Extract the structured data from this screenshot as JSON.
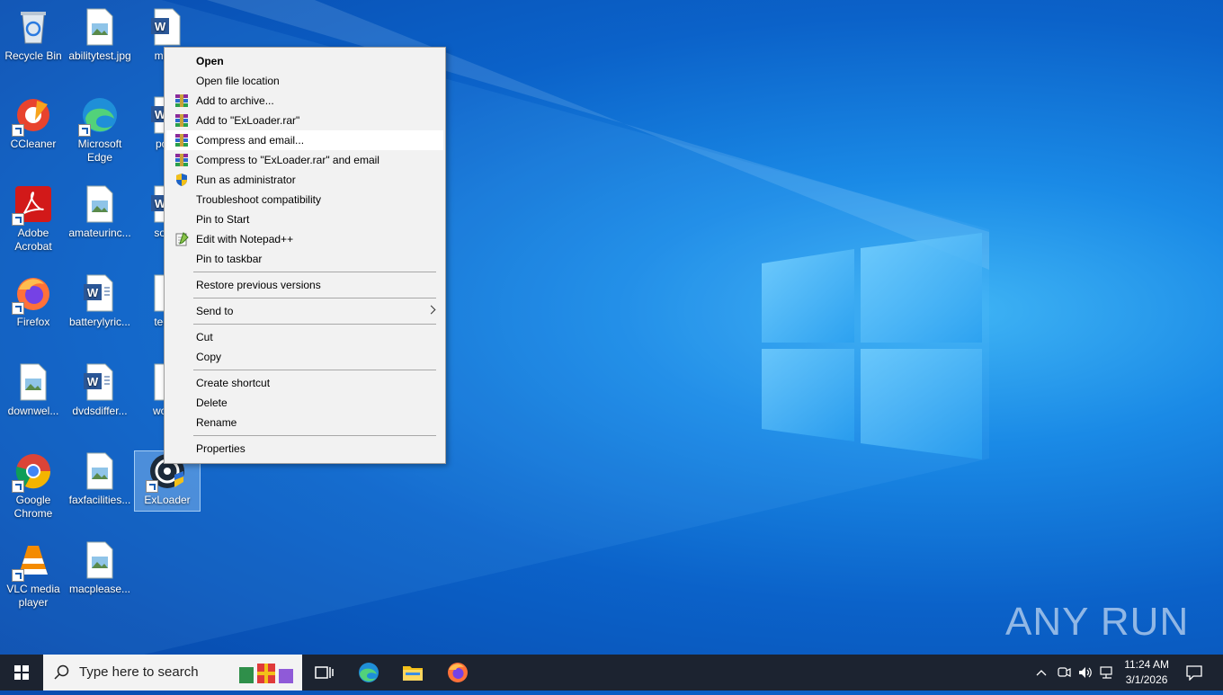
{
  "desktop": {
    "icons": [
      {
        "label": "Recycle Bin"
      },
      {
        "label": "abilitytest.jpg"
      },
      {
        "label": "muck"
      },
      {
        "label": "CCleaner"
      },
      {
        "label": "Microsoft Edge"
      },
      {
        "label": "point"
      },
      {
        "label": "Adobe Acrobat"
      },
      {
        "label": "amateurinc..."
      },
      {
        "label": "some"
      },
      {
        "label": "Firefox"
      },
      {
        "label": "batterylyric..."
      },
      {
        "label": "teens"
      },
      {
        "label": "downwel..."
      },
      {
        "label": "dvdsdiffer..."
      },
      {
        "label": "woma"
      },
      {
        "label": "Google Chrome"
      },
      {
        "label": "faxfacilities..."
      },
      {
        "label": "ExLoader"
      },
      {
        "label": "VLC media player"
      },
      {
        "label": "macplease..."
      }
    ]
  },
  "context_menu": {
    "items": [
      {
        "label": "Open",
        "icon": "none"
      },
      {
        "label": "Open file location",
        "icon": "none"
      },
      {
        "label": "Add to archive...",
        "icon": "winrar-icon"
      },
      {
        "label": "Add to \"ExLoader.rar\"",
        "icon": "winrar-icon"
      },
      {
        "label": "Compress and email...",
        "icon": "winrar-icon"
      },
      {
        "label": "Compress to \"ExLoader.rar\" and email",
        "icon": "winrar-icon"
      },
      {
        "label": "Run as administrator",
        "icon": "uac-shield-icon"
      },
      {
        "label": "Troubleshoot compatibility",
        "icon": "none"
      },
      {
        "label": "Pin to Start",
        "icon": "none"
      },
      {
        "label": "Edit with Notepad++",
        "icon": "notepadpp-icon"
      },
      {
        "label": "Pin to taskbar",
        "icon": "none"
      },
      {
        "label": "Restore previous versions",
        "icon": "none"
      },
      {
        "label": "Send to",
        "icon": "none"
      },
      {
        "label": "Cut",
        "icon": "none"
      },
      {
        "label": "Copy",
        "icon": "none"
      },
      {
        "label": "Create shortcut",
        "icon": "none"
      },
      {
        "label": "Delete",
        "icon": "none"
      },
      {
        "label": "Rename",
        "icon": "none"
      },
      {
        "label": "Properties",
        "icon": "none"
      }
    ]
  },
  "taskbar": {
    "search_placeholder": "Type here to search",
    "clock_time": "11:24 AM",
    "clock_date": "3/1/2026"
  },
  "watermark": {
    "text": "ANY RUN"
  }
}
